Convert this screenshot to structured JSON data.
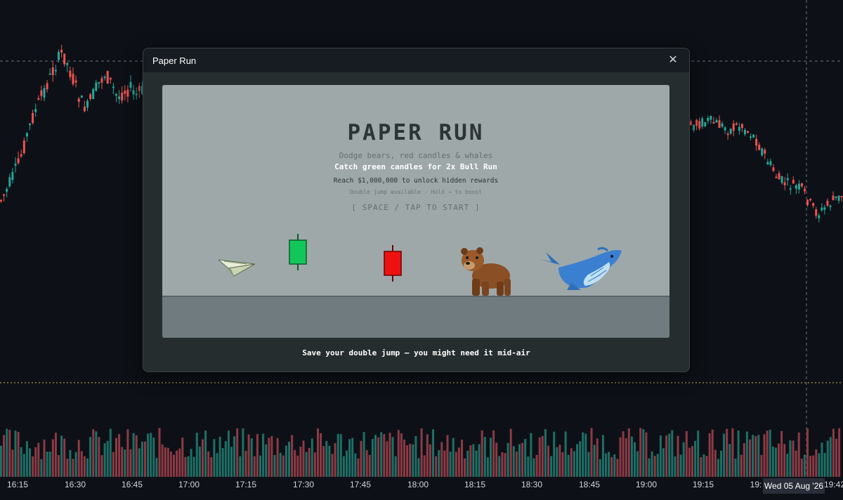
{
  "chart": {
    "time_axis": [
      "16:15",
      "16:30",
      "16:45",
      "17:00",
      "17:15",
      "17:30",
      "17:45",
      "18:00",
      "18:15",
      "18:30",
      "18:45",
      "19:00",
      "19:15",
      "19:",
      "19:42"
    ],
    "crosshair_date": "Wed 05 Aug '26",
    "colors": {
      "up": "#26a69a",
      "down": "#ef5350",
      "background": "#0d1117"
    }
  },
  "modal": {
    "title": "Paper Run",
    "close_icon": "close-icon"
  },
  "game": {
    "title": "PAPER RUN",
    "subtitle": "Dodge bears, red candles & whales",
    "highlight": "Catch green candles for 2x Bull Run",
    "goal": "Reach $1,000,000 to unlock hidden rewards",
    "hint": "Double jump available - Hold → to boost",
    "start_prompt": "[ SPACE / TAP TO START ]",
    "sprites": [
      "paper-plane-icon",
      "green-candle-icon",
      "red-candle-icon",
      "bear-icon",
      "whale-icon"
    ]
  },
  "footer": {
    "tip": "Save your double jump — you might need it mid-air"
  }
}
